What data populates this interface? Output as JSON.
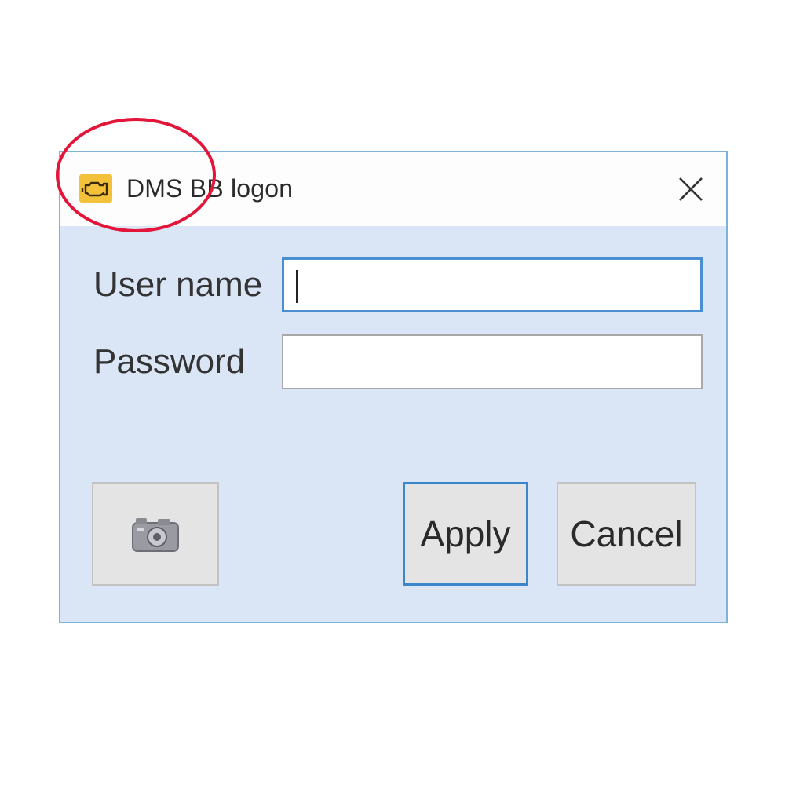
{
  "window": {
    "title": "DMS BB logon",
    "app_icon": "engine-warning-icon",
    "close_icon": "close-icon"
  },
  "form": {
    "username_label": "User name",
    "username_value": "",
    "password_label": "Password",
    "password_value": ""
  },
  "buttons": {
    "camera_icon": "camera-icon",
    "apply_label": "Apply",
    "cancel_label": "Cancel"
  },
  "colors": {
    "dialog_background": "#dae6f5",
    "title_bar": "#fdfdfd",
    "focus_border": "#3c86cc",
    "app_icon": "#f3c23a",
    "highlight_ring": "#e3163a"
  }
}
